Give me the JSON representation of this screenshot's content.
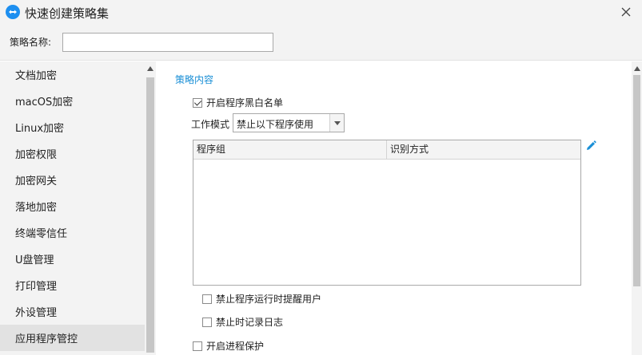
{
  "window": {
    "title": "快速创建策略集",
    "app_icon": "app-logo-icon",
    "close_icon": "close-icon"
  },
  "policy_name": {
    "label": "策略名称:",
    "value": "",
    "placeholder": ""
  },
  "sidebar": {
    "items": [
      {
        "label": "文档加密"
      },
      {
        "label": "macOS加密"
      },
      {
        "label": "Linux加密"
      },
      {
        "label": "加密权限"
      },
      {
        "label": "加密网关"
      },
      {
        "label": "落地加密"
      },
      {
        "label": "终端零信任"
      },
      {
        "label": "U盘管理"
      },
      {
        "label": "打印管理"
      },
      {
        "label": "外设管理"
      },
      {
        "label": "应用程序管控"
      }
    ],
    "active_index": 10
  },
  "content": {
    "section_title": "策略内容",
    "enable_whitelist": {
      "label": "开启程序黑白名单",
      "checked": true
    },
    "work_mode": {
      "label": "工作模式",
      "value": "禁止以下程序使用"
    },
    "table": {
      "columns": [
        "程序组",
        "识别方式"
      ],
      "rows": []
    },
    "edit_icon": "pencil-edit-icon",
    "notify_user": {
      "label": "禁止程序运行时提醒用户",
      "checked": false
    },
    "log_event": {
      "label": "禁止时记录日志",
      "checked": false
    },
    "process_protect": {
      "label": "开启进程保护",
      "checked": false
    }
  },
  "colors": {
    "accent": "#1a8fd6",
    "sidebar_bg": "#f3f3f3",
    "sidebar_active": "#e2e2e2"
  }
}
